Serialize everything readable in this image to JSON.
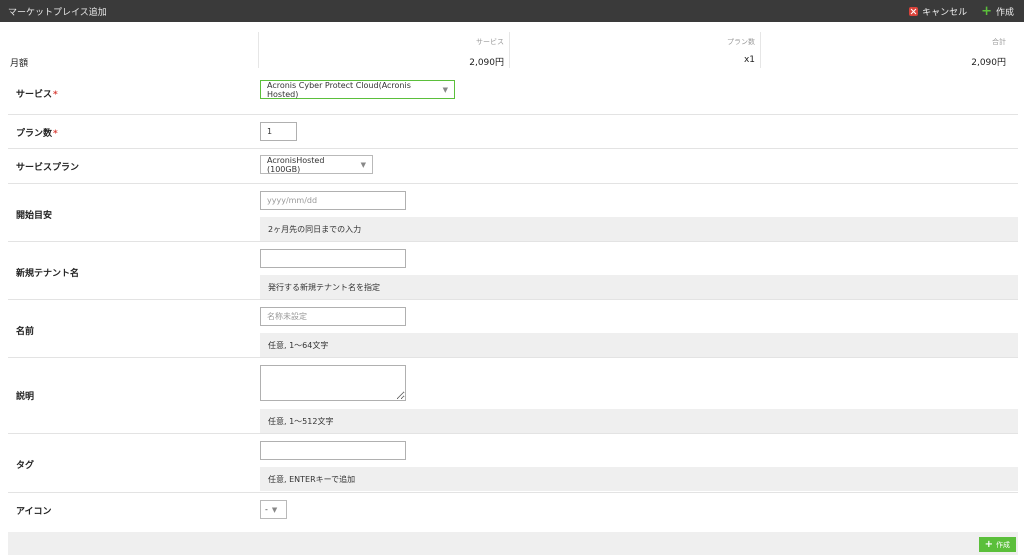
{
  "header": {
    "title": "マーケットプレイス追加",
    "cancel_label": "キャンセル",
    "create_label": "作成"
  },
  "summary": {
    "row_label": "月額",
    "columns": [
      {
        "header": "サービス",
        "value": "2,090円"
      },
      {
        "header": "プラン数",
        "value": "x1"
      },
      {
        "header": "合計",
        "value": "2,090円"
      }
    ]
  },
  "form": {
    "service": {
      "label": "サービス",
      "required_mark": "*",
      "value": "Acronis Cyber Protect Cloud(Acronis Hosted)"
    },
    "plan_count": {
      "label": "プラン数",
      "required_mark": "*",
      "value": "1"
    },
    "service_plan": {
      "label": "サービスプラン",
      "value": "AcronisHosted (100GB)"
    },
    "start_date": {
      "label": "開始目安",
      "placeholder": "yyyy/mm/dd",
      "hint": "2ヶ月先の同日までの入力"
    },
    "tenant_name": {
      "label": "新規テナント名",
      "value": "",
      "hint": "発行する新規テナント名を指定"
    },
    "name": {
      "label": "名前",
      "placeholder": "名称未設定",
      "hint": "任意, 1～64文字"
    },
    "description": {
      "label": "説明",
      "value": "",
      "hint": "任意, 1～512文字"
    },
    "tag": {
      "label": "タグ",
      "value": "",
      "hint": "任意, ENTERキーで追加"
    },
    "icon": {
      "label": "アイコン",
      "value": "-"
    }
  },
  "footer": {
    "create_label": "作成"
  },
  "colors": {
    "titlebar": "#3a3a3a",
    "accent_green": "#5bbf3b",
    "cancel_red": "#d9433b",
    "hint_bg": "#efefef"
  }
}
